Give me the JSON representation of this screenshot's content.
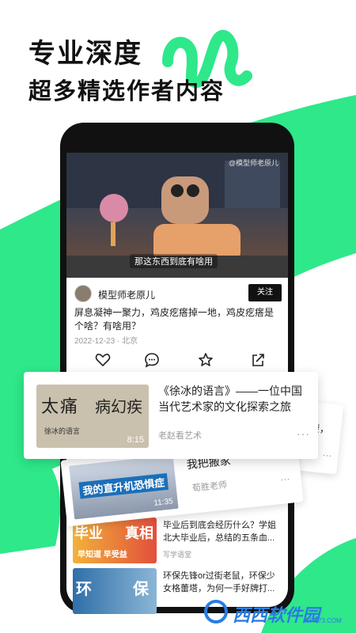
{
  "promo": {
    "headline": "专业深度",
    "subhead": "超多精选作者内容"
  },
  "colors": {
    "brand_green": "#2ee88a",
    "phone_frame": "#111111",
    "follow_bg": "#111111"
  },
  "post": {
    "video_watermark": "@模型师老原儿",
    "video_subtitle": "那这东西到底有啥用",
    "author_name": "模型师老原儿",
    "follow_label": "关注",
    "text": "屏息凝神一聚力，鸡皮疙瘩掉一地，鸡皮疙瘩是个啥？有啥用？",
    "date": "2022-12-23",
    "location": "北京",
    "meta_sep": " · ",
    "actions": [
      "heart-icon",
      "comment-icon",
      "star-icon",
      "share-icon"
    ]
  },
  "card_main": {
    "thumb_calligraphy_1": "太痛",
    "thumb_calligraphy_2": "病幻疾",
    "thumb_caption": "徐冰的语言",
    "thumb_duration": "8:15",
    "title": "《徐冰的语言》——一位中国当代艺术家的文化探索之旅",
    "author": "老赵看艺术",
    "more": "···"
  },
  "card_back": {
    "title_fragment": "旋，",
    "more": "···"
  },
  "card_mid": {
    "thumb_caption": "我的直升机恐惧症",
    "thumb_duration": "11:35",
    "title_fragment": "我把搬家",
    "author": "荀胜老师",
    "more": "···"
  },
  "feed": [
    {
      "thumb_text_1": "毕业",
      "thumb_text_2": "真相",
      "thumb_caption": "早知道 早受益",
      "title": "毕业后到底会经历什么？学姐北大毕业后，总结的五条血...",
      "source": "写学语堂"
    },
    {
      "thumb_text_1": "环",
      "thumb_text_2": "保",
      "title": "环保先锋or过街老鼠，环保少女格蕾塔，为何一手好牌打...",
      "source": ""
    }
  ],
  "watermark_logo": {
    "brand": "西西软件园",
    "site": "CR173.COM"
  }
}
